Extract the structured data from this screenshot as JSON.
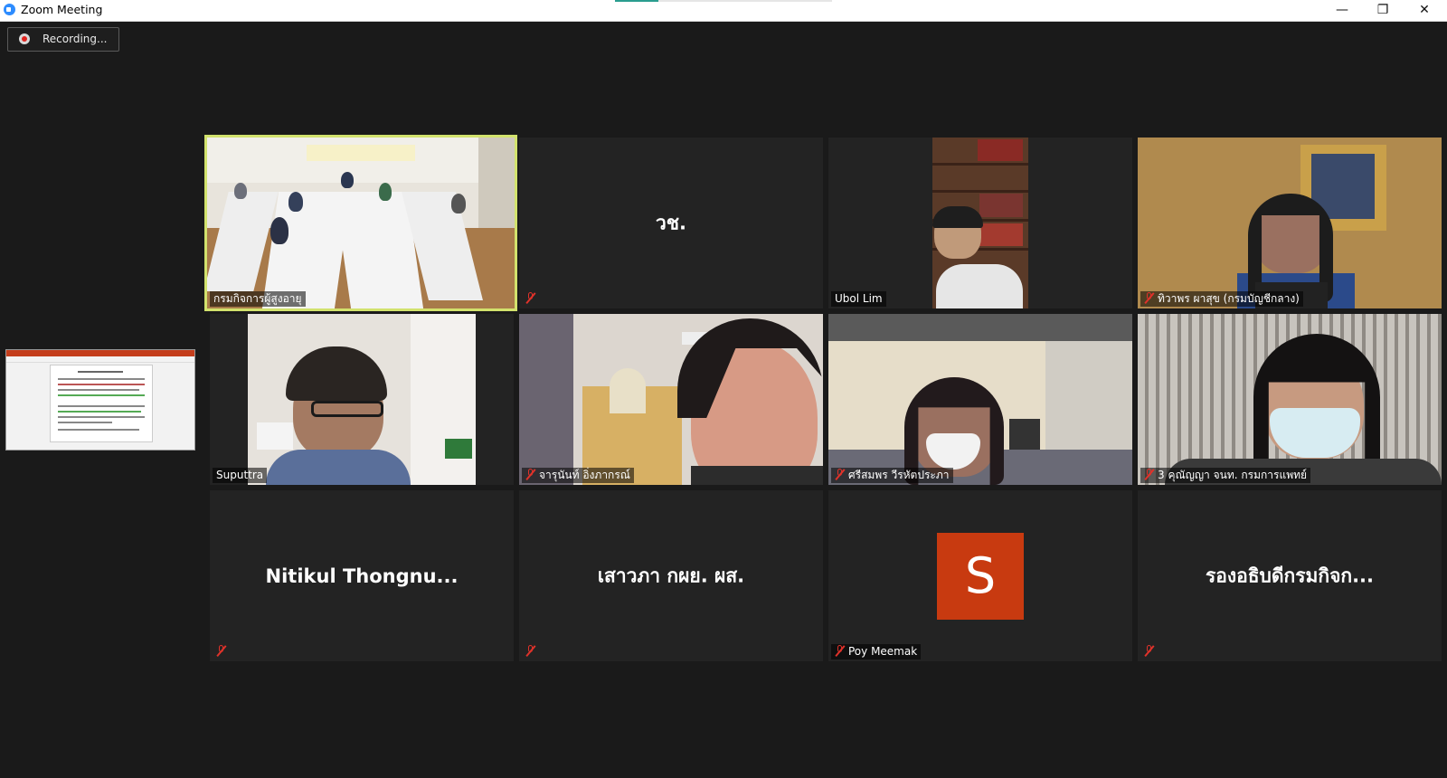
{
  "window": {
    "title": "Zoom Meeting",
    "minimize": "—",
    "restore": "❐",
    "close": "✕"
  },
  "recording": {
    "label": "Recording..."
  },
  "share_thumbnail": {
    "icon": "screen-share-thumbnail"
  },
  "participants": [
    {
      "name": "กรมกิจการผู้สูงอายุ",
      "video": true,
      "muted": false,
      "active": true
    },
    {
      "name": "",
      "display": "วช.",
      "video": false,
      "muted": true
    },
    {
      "name": "Ubol Lim",
      "video": true,
      "muted": false
    },
    {
      "name": "ทิวาพร ผาสุข (กรมบัญชีกลาง)",
      "video": true,
      "muted": true
    },
    {
      "name": "Suputtra",
      "video": true,
      "muted": false
    },
    {
      "name": "จารุนันท์ อิ่งภากรณ์",
      "video": true,
      "muted": true
    },
    {
      "name": "ศรีสมพร วีรหัตประภา",
      "video": true,
      "muted": true
    },
    {
      "name": "3 คุณัญญา จนท. กรมการแพทย์",
      "video": true,
      "muted": true
    },
    {
      "name": "",
      "display": "Nitikul  Thongnu...",
      "video": false,
      "muted": true
    },
    {
      "name": "",
      "display": "เสาวภา กผย. ผส.",
      "video": false,
      "muted": true
    },
    {
      "name": "Poy Meemak",
      "avatar_letter": "S",
      "avatar_color": "#c83a10",
      "video": false,
      "muted": true
    },
    {
      "name": "",
      "display": "รองอธิบดีกรมกิจก...",
      "video": false,
      "muted": true
    }
  ],
  "colors": {
    "active_speaker_border": "#d2e26d",
    "mute_red": "#e0322a",
    "background": "#1a1a1a",
    "tile": "#232323"
  }
}
